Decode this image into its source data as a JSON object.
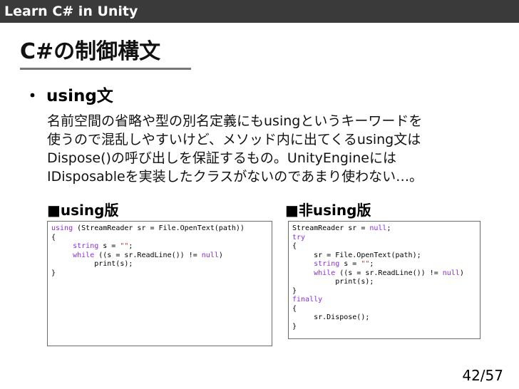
{
  "header": {
    "title": "Learn C# in Unity"
  },
  "slide": {
    "title": "C#の制御構文",
    "bullet_symbol": "・",
    "bullet_label": "using文",
    "body_lines": [
      "名前空間の省略や型の別名定義にもusingというキーワードを",
      "使うので混乱しやすいけど、メソッド内に出てくるusing文は",
      "Dispose()の呼び出しを保証するもの。UnityEngineには",
      "IDisposableを実装したクラスがないのであまり使わない…。"
    ],
    "left_heading": "■using版",
    "right_heading": "■非using版",
    "left_code": [
      [
        {
          "t": "using",
          "k": "kw"
        },
        {
          "t": " (StreamReader sr = File.OpenText(path))"
        }
      ],
      [
        {
          "t": "{"
        }
      ],
      [
        {
          "t": "     "
        },
        {
          "t": "string",
          "k": "kw"
        },
        {
          "t": " s = "
        },
        {
          "t": "\"\"",
          "k": "str"
        },
        {
          "t": ";"
        }
      ],
      [
        {
          "t": "     "
        },
        {
          "t": "while",
          "k": "kw"
        },
        {
          "t": " ((s = sr.ReadLine()) != "
        },
        {
          "t": "null",
          "k": "kw"
        },
        {
          "t": ")"
        }
      ],
      [
        {
          "t": "          print(s);"
        }
      ],
      [
        {
          "t": "}"
        }
      ]
    ],
    "right_code": [
      [
        {
          "t": "StreamReader sr = "
        },
        {
          "t": "null",
          "k": "kw"
        },
        {
          "t": ";"
        }
      ],
      [
        {
          "t": "try",
          "k": "kw"
        }
      ],
      [
        {
          "t": "{"
        }
      ],
      [
        {
          "t": "     sr = File.OpenText(path);"
        }
      ],
      [
        {
          "t": "     "
        },
        {
          "t": "string",
          "k": "kw"
        },
        {
          "t": " s = "
        },
        {
          "t": "\"\"",
          "k": "str"
        },
        {
          "t": ";"
        }
      ],
      [
        {
          "t": "     "
        },
        {
          "t": "while",
          "k": "kw"
        },
        {
          "t": " ((s = sr.ReadLine()) != "
        },
        {
          "t": "null",
          "k": "kw"
        },
        {
          "t": ")"
        }
      ],
      [
        {
          "t": "          print(s);"
        }
      ],
      [
        {
          "t": "}"
        }
      ],
      [
        {
          "t": "finally",
          "k": "kw"
        }
      ],
      [
        {
          "t": "{"
        }
      ],
      [
        {
          "t": "     sr.Dispose();"
        }
      ],
      [
        {
          "t": "}"
        }
      ]
    ],
    "page_number": "42/57"
  },
  "colors": {
    "header_bg": "#3a3a3a",
    "keyword": "#8a2be2",
    "string": "#c0392b"
  }
}
